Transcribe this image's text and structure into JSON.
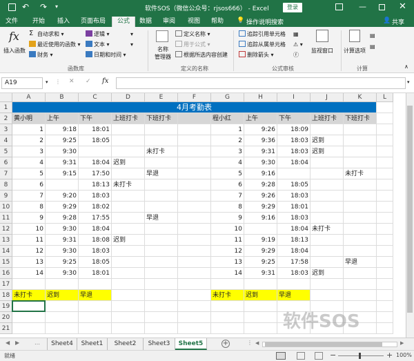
{
  "title_bar": {
    "title": "软件SOS（微信公众号：rjsos666）  -  Excel",
    "login_label": "登录"
  },
  "ribbon_tabs": [
    "文件",
    "开始",
    "插入",
    "页面布局",
    "公式",
    "数据",
    "审阅",
    "视图",
    "帮助"
  ],
  "active_tab": "公式",
  "tell_me": "操作说明搜索",
  "share_label": "共享",
  "ribbon": {
    "insert_function": "插入函数",
    "autosum": "自动求和",
    "recent": "最近使用的函数",
    "financial": "财务",
    "logical": "逻辑",
    "text": "文本",
    "datetime": "日期和时间",
    "name_manager_1": "名称",
    "name_manager_2": "管理器",
    "define_name": "定义名称",
    "use_in_formula": "用于公式",
    "create_from_selection": "根据所选内容创建",
    "trace_precedents": "追踪引用单元格",
    "trace_dependents": "追踪从属单元格",
    "remove_arrows": "删除箭头",
    "watch_window": "监视窗口",
    "calc_options": "计算选项",
    "group_library": "函数库",
    "group_names": "定义的名称",
    "group_audit": "公式审核",
    "group_calc": "计算"
  },
  "formula_bar": {
    "name_box": "A19",
    "fx": "fx",
    "content": ""
  },
  "columns": [
    "A",
    "B",
    "C",
    "D",
    "E",
    "F",
    "G",
    "H",
    "I",
    "J",
    "K",
    "L"
  ],
  "row_numbers": [
    "1",
    "2",
    "3",
    "4",
    "5",
    "6",
    "7",
    "8",
    "9",
    "10",
    "11",
    "12",
    "13",
    "14",
    "15",
    "16",
    "17",
    "18",
    "19",
    "20",
    "21"
  ],
  "sheet": {
    "title": "4月考勤表",
    "left_header": [
      "黄小明",
      "上午",
      "下午",
      "上班打卡",
      "下班打卡"
    ],
    "right_header": [
      "程小红",
      "上午",
      "下午",
      "上班打卡",
      "下班打卡"
    ],
    "left_rows": [
      [
        "1",
        "9:18",
        "18:01",
        "",
        ""
      ],
      [
        "2",
        "9:25",
        "18:05",
        "",
        ""
      ],
      [
        "3",
        "9:30",
        "",
        "",
        "未打卡"
      ],
      [
        "4",
        "9:31",
        "18:04",
        "迟到",
        ""
      ],
      [
        "5",
        "9:15",
        "17:50",
        "",
        "早退"
      ],
      [
        "6",
        "",
        "18:13",
        "未打卡",
        ""
      ],
      [
        "7",
        "9:20",
        "18:03",
        "",
        ""
      ],
      [
        "8",
        "9:29",
        "18:02",
        "",
        ""
      ],
      [
        "9",
        "9:28",
        "17:55",
        "",
        "早退"
      ],
      [
        "10",
        "9:30",
        "18:04",
        "",
        ""
      ],
      [
        "11",
        "9:31",
        "18:08",
        "迟到",
        ""
      ],
      [
        "12",
        "9:30",
        "18:03",
        "",
        ""
      ],
      [
        "13",
        "9:25",
        "18:05",
        "",
        ""
      ],
      [
        "14",
        "9:30",
        "18:01",
        "",
        ""
      ]
    ],
    "right_rows": [
      [
        "1",
        "9:26",
        "18:09",
        "",
        ""
      ],
      [
        "2",
        "9:36",
        "18:03",
        "迟到",
        ""
      ],
      [
        "3",
        "9:31",
        "18:03",
        "迟到",
        ""
      ],
      [
        "4",
        "9:30",
        "18:04",
        "",
        ""
      ],
      [
        "5",
        "9:16",
        "",
        "",
        "未打卡"
      ],
      [
        "6",
        "9:28",
        "18:05",
        "",
        ""
      ],
      [
        "7",
        "9:26",
        "18:03",
        "",
        ""
      ],
      [
        "8",
        "9:29",
        "18:01",
        "",
        ""
      ],
      [
        "9",
        "9:16",
        "18:03",
        "",
        ""
      ],
      [
        "10",
        "",
        "18:04",
        "未打卡",
        ""
      ],
      [
        "11",
        "9:19",
        "18:13",
        "",
        ""
      ],
      [
        "12",
        "9:29",
        "18:04",
        "",
        ""
      ],
      [
        "13",
        "9:25",
        "17:58",
        "",
        "早退"
      ],
      [
        "14",
        "9:31",
        "18:03",
        "迟到",
        ""
      ]
    ],
    "left_legend": [
      "未打卡",
      "迟到",
      "早退"
    ],
    "right_legend": [
      "未打卡",
      "迟到",
      "早退"
    ]
  },
  "watermark": "软件SOS",
  "sheet_tabs": [
    "Sheet4",
    "Sheet1",
    "Sheet2",
    "Sheet3",
    "Sheet5"
  ],
  "active_sheet": "Sheet5",
  "status": {
    "mode": "就绪",
    "zoom": "100%"
  },
  "colors": {
    "excel_green": "#217346",
    "title_band": "#0070c0",
    "highlight_yellow": "#ffff00"
  }
}
